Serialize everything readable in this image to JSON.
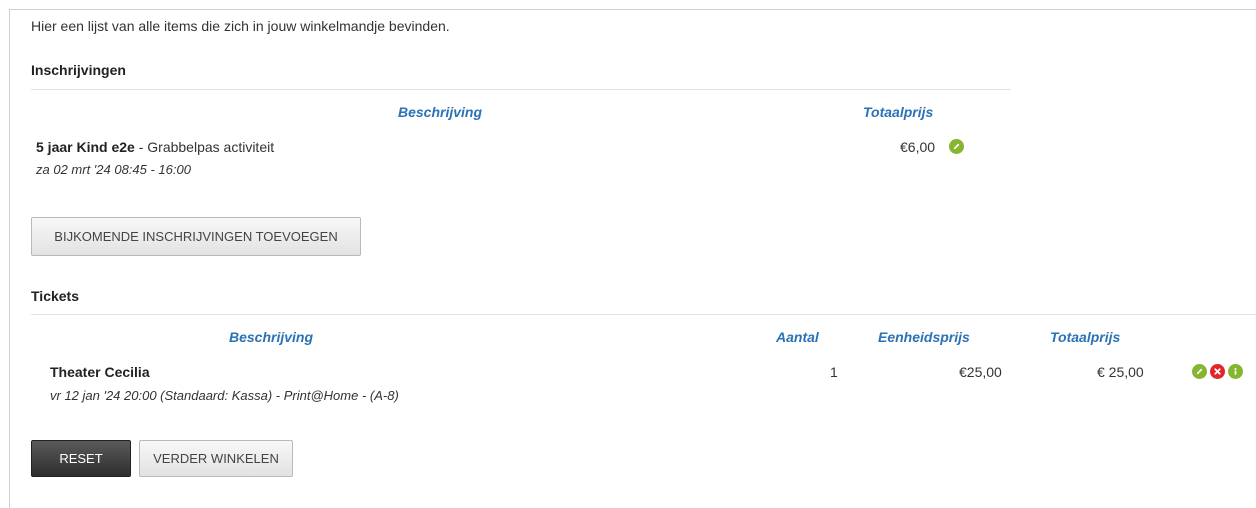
{
  "intro": "Hier een lijst van alle items die zich in jouw winkelmandje bevinden.",
  "registrations": {
    "title": "Inschrijvingen",
    "col_description": "Beschrijving",
    "col_total": "Totaalprijs",
    "items": [
      {
        "name": "5 jaar Kind e2e",
        "detail": " - Grabbelpas activiteit",
        "date": "za 02 mrt '24 08:45 - 16:00",
        "total": "€6,00"
      }
    ],
    "add_button": "BIJKOMENDE INSCHRIJVINGEN TOEVOEGEN"
  },
  "tickets": {
    "title": "Tickets",
    "col_description": "Beschrijving",
    "col_quantity": "Aantal",
    "col_unit_price": "Eenheidsprijs",
    "col_total": "Totaalprijs",
    "items": [
      {
        "name": "Theater Cecilia",
        "detail": "vr 12 jan '24 20:00 (",
        "detail_italic": "Standaard: Kassa",
        "detail_rest": ") - Print@Home - (A-8)",
        "quantity": "1",
        "unit_price": "€25,00",
        "total": "€ 25,00"
      }
    ]
  },
  "buttons": {
    "reset": "RESET",
    "continue": "VERDER WINKELEN"
  },
  "colors": {
    "header_blue": "#2b72b6",
    "icon_green": "#86b52f",
    "icon_red": "#e0262b"
  },
  "icons": [
    "edit-icon",
    "remove-icon",
    "info-icon"
  ]
}
